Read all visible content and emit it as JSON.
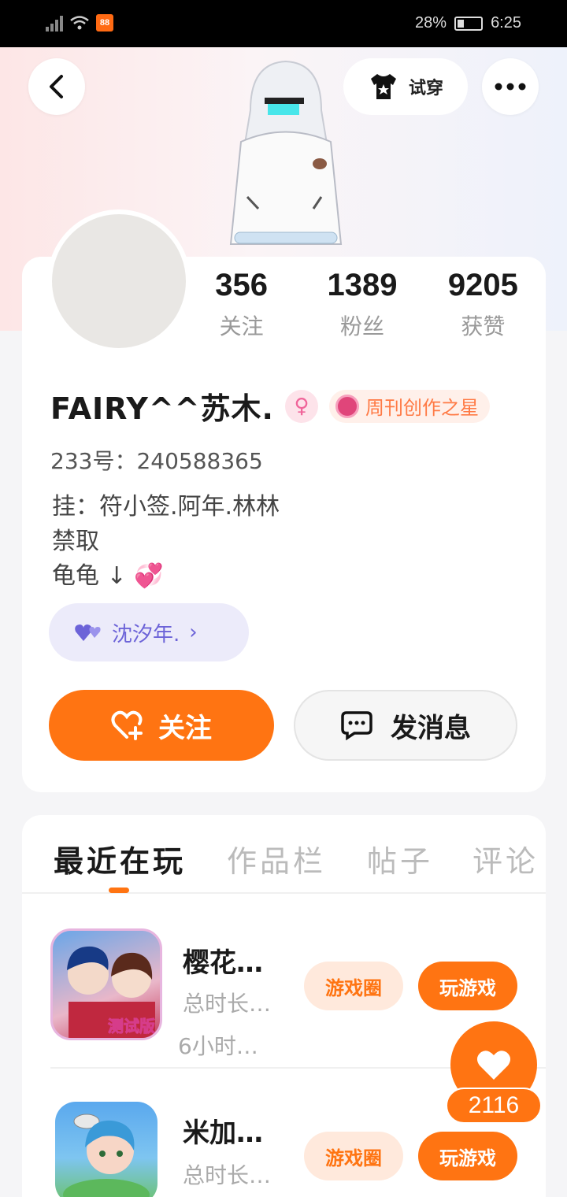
{
  "status_bar": {
    "battery": "28%",
    "time": "6:25"
  },
  "header": {
    "try_on_label": "试穿"
  },
  "profile": {
    "stats": [
      {
        "value": "356",
        "label": "关注"
      },
      {
        "value": "1389",
        "label": "粉丝"
      },
      {
        "value": "9205",
        "label": "获赞"
      }
    ],
    "name": "FAIRY^^苏木.",
    "gender_symbol": "♀",
    "title_badge": "周刊创作之星",
    "uid": "233号：240588365",
    "bio_lines": [
      "挂：符小签.阿年.林林",
      "禁取",
      "龟龟 ↓"
    ],
    "friend_label": "沈汐年.",
    "follow_label": "关注",
    "message_label": "发消息"
  },
  "tabs": [
    "最近在玩",
    "作品栏",
    "帖子",
    "评论"
  ],
  "games": [
    {
      "title": "樱花…",
      "line1": "总时长…",
      "line2": "6小时…",
      "icon_badge": "测试版",
      "circle_label": "游戏圈",
      "play_label": "玩游戏"
    },
    {
      "title": "米加…",
      "line1": "总时长…",
      "line2": "",
      "circle_label": "游戏圈",
      "play_label": "玩游戏"
    }
  ],
  "likes": {
    "count": "2116"
  },
  "colors": {
    "accent": "#ff7412",
    "friend": "#6c63d8"
  }
}
